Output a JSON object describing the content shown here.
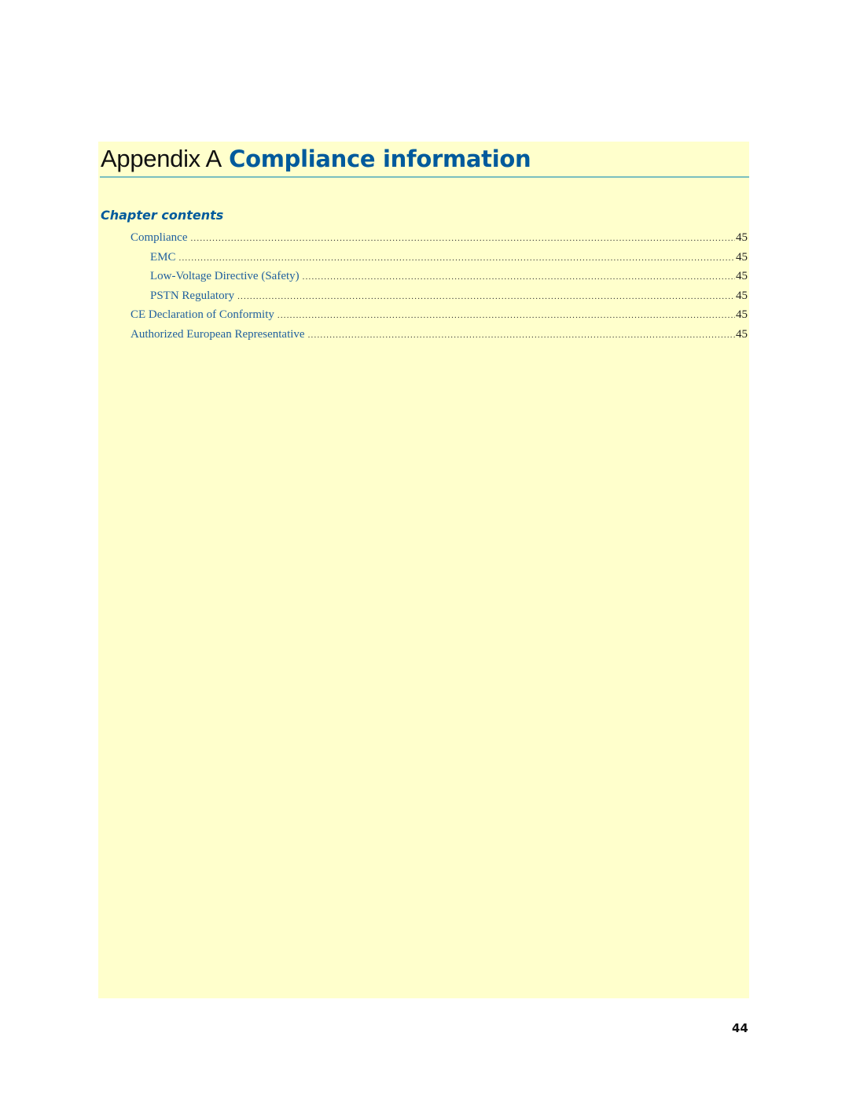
{
  "header": {
    "prefix": "Appendix A",
    "title": "Compliance information"
  },
  "chapter_contents": {
    "heading": "Chapter contents",
    "entries": [
      {
        "label": "Compliance",
        "page": "45",
        "level": 1
      },
      {
        "label": "EMC",
        "page": "45",
        "level": 2
      },
      {
        "label": "Low-Voltage Directive (Safety)",
        "page": "45",
        "level": 2
      },
      {
        "label": "PSTN Regulatory",
        "page": "45",
        "level": 2
      },
      {
        "label": "CE Declaration of Conformity",
        "page": "45",
        "level": 1
      },
      {
        "label": "Authorized European Representative",
        "page": "45",
        "level": 1
      }
    ]
  },
  "footer": {
    "page_number": "44"
  },
  "colors": {
    "panel_background": "#ffffcc",
    "accent_blue": "#005a9c",
    "rule": "#7bbfbf"
  }
}
